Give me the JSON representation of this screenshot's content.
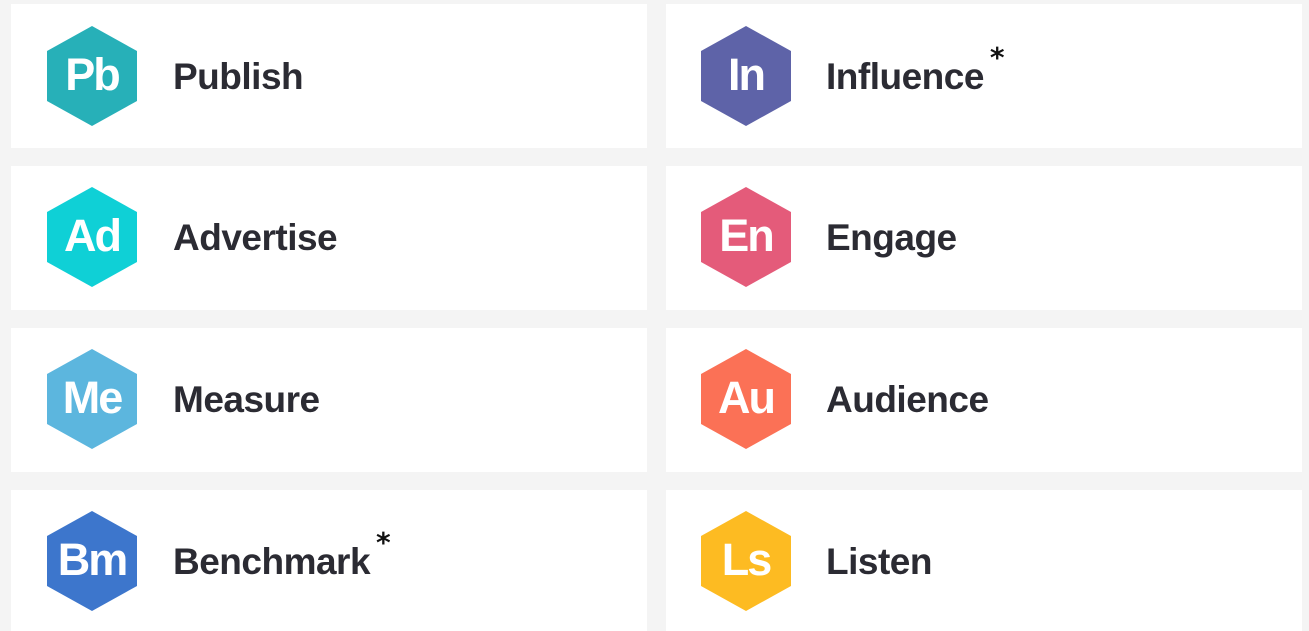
{
  "modules": [
    {
      "abbr": "Pb",
      "label": "Publish",
      "color": "#27b0b8",
      "note": ""
    },
    {
      "abbr": "In",
      "label": "Influence",
      "color": "#5e63a8",
      "note": "*"
    },
    {
      "abbr": "Ad",
      "label": "Advertise",
      "color": "#0fd0d6",
      "note": ""
    },
    {
      "abbr": "En",
      "label": "Engage",
      "color": "#e45b7a",
      "note": ""
    },
    {
      "abbr": "Me",
      "label": "Measure",
      "color": "#5cb6de",
      "note": ""
    },
    {
      "abbr": "Au",
      "label": "Audience",
      "color": "#fb7156",
      "note": ""
    },
    {
      "abbr": "Bm",
      "label": "Benchmark",
      "color": "#3d76cc",
      "note": "*"
    },
    {
      "abbr": "Ls",
      "label": "Listen",
      "color": "#fdbb22",
      "note": ""
    }
  ]
}
